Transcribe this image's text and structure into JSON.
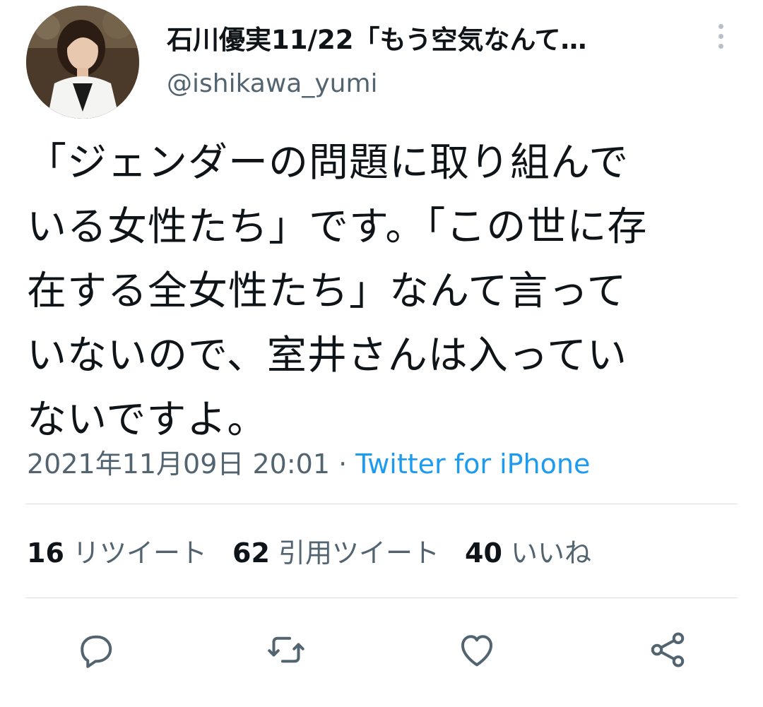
{
  "user": {
    "display_name": "石川優実11/22「もう空気なんて…",
    "handle": "@ishikawa_yumi"
  },
  "tweet": {
    "lines": [
      "「ジェンダーの問題に取り組んで",
      "いる女性たち」です。「この世に存",
      "在する全女性たち」なんて言って",
      "いないので、室井さんは入ってい",
      "ないですよ。"
    ],
    "timestamp": "2021年11月09日 20:01",
    "separator": "·",
    "source": "Twitter for iPhone"
  },
  "stats": {
    "retweets": {
      "count": "16",
      "label": "リツイート"
    },
    "quotes": {
      "count": "62",
      "label": "引用ツイート"
    },
    "likes": {
      "count": "40",
      "label": "いいね"
    }
  },
  "icons": {
    "more": "more-vertical-icon",
    "reply": "reply-icon",
    "retweet": "retweet-icon",
    "like": "heart-icon",
    "share": "share-icon"
  },
  "colors": {
    "text": "#0f1419",
    "secondary": "#536471",
    "link": "#1d9bf0",
    "divider": "#d9dee2"
  }
}
